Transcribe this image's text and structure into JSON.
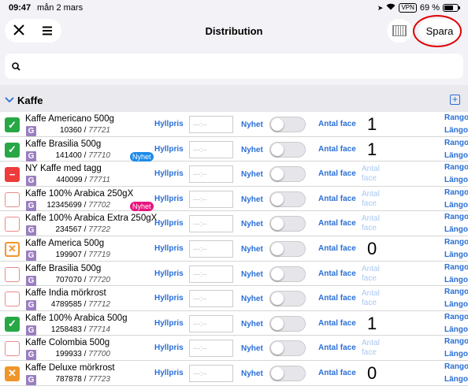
{
  "status": {
    "time": "09:47",
    "date": "mån 2 mars",
    "vpn": "VPN",
    "battery": "69 %"
  },
  "nav": {
    "close_icon": "close-icon",
    "menu_icon": "hamburger-icon",
    "title": "Distribution",
    "barcode_icon": "barcode-icon",
    "save_label": "Spara"
  },
  "search": {
    "icon": "search-icon"
  },
  "section": {
    "title": "Kaffe",
    "add_icon": "plus-square-icon"
  },
  "labels": {
    "shelf_price": "Hyllpris",
    "price_placeholder": "---:--",
    "new": "Nyhet",
    "facings": "Antal face",
    "rank": "Rango",
    "length": "Längo"
  },
  "products": [
    {
      "name": "Kaffe Americano 500g",
      "code": "10360",
      "id": "77721",
      "state": "checked",
      "facings": "1",
      "tag": ""
    },
    {
      "name": "Kaffe Brasilia 500g",
      "code": "141400",
      "id": "77710",
      "state": "checked",
      "facings": "1",
      "tag": "Nyhet"
    },
    {
      "name": "NY Kaffe med tagg",
      "code": "440099",
      "id": "77711",
      "state": "dash",
      "facings": "",
      "tag": ""
    },
    {
      "name": "Kaffe 100% Arabica 250gX",
      "code": "12345699",
      "id": "77702",
      "state": "empty",
      "facings": "",
      "tag": "Nyhet"
    },
    {
      "name": "Kaffe 100% Arabica Extra 250gX",
      "code": "234567",
      "id": "77722",
      "state": "empty",
      "facings": "",
      "tag": ""
    },
    {
      "name": "Kaffe America 500g",
      "code": "199907",
      "id": "77719",
      "state": "cross",
      "facings": "0",
      "tag": ""
    },
    {
      "name": "Kaffe Brasilia 500g",
      "code": "707070",
      "id": "77720",
      "state": "empty",
      "facings": "",
      "tag": ""
    },
    {
      "name": "Kaffe India mörkrost",
      "code": "4789585",
      "id": "77712",
      "state": "empty",
      "facings": "",
      "tag": ""
    },
    {
      "name": "Kaffe 100% Arabica 500g",
      "code": "1258483",
      "id": "77714",
      "state": "checked",
      "facings": "1",
      "tag": ""
    },
    {
      "name": "Kaffe Colombia 500g",
      "code": "199933",
      "id": "77700",
      "state": "empty",
      "facings": "",
      "tag": ""
    },
    {
      "name": "Kaffe Deluxe mörkrost",
      "code": "787878",
      "id": "77723",
      "state": "crossfill",
      "facings": "0",
      "tag": ""
    }
  ],
  "colors": {
    "check_green": "#27a745",
    "check_red": "#ee3b3b",
    "cross_orange": "#f0952b",
    "link_blue": "#2a6fd6",
    "group_purple": "#9a7fc0",
    "tag_blue": "#1e8be8",
    "tag_pink": "#e8157e",
    "highlight_red": "#dd0000"
  }
}
